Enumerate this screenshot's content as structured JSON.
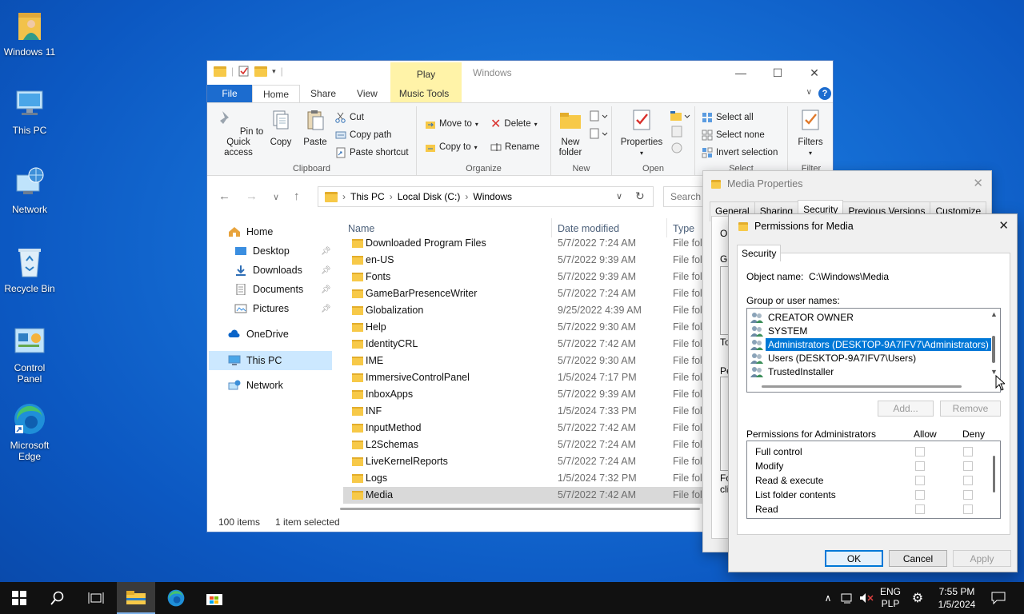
{
  "desktop": {
    "icons": [
      {
        "label": "Windows 11"
      },
      {
        "label": "This PC"
      },
      {
        "label": "Network"
      },
      {
        "label": "Recycle Bin"
      },
      {
        "label": "Control Panel"
      },
      {
        "label": "Microsoft Edge"
      }
    ]
  },
  "explorer": {
    "title": "Windows",
    "play_tab": "Play",
    "tabs": {
      "file": "File",
      "home": "Home",
      "share": "Share",
      "view": "View",
      "music_tools": "Music Tools"
    },
    "ribbon": {
      "pin": "Pin to Quick access",
      "copy": "Copy",
      "paste": "Paste",
      "cut": "Cut",
      "copy_path": "Copy path",
      "paste_shortcut": "Paste shortcut",
      "clipboard": "Clipboard",
      "move_to": "Move to",
      "copy_to": "Copy to",
      "delete": "Delete",
      "rename": "Rename",
      "organize": "Organize",
      "new_folder": "New folder",
      "new": "New",
      "properties": "Properties",
      "open": "Open",
      "select_all": "Select all",
      "select_none": "Select none",
      "invert_selection": "Invert selection",
      "select": "Select",
      "filters": "Filters",
      "filter": "Filter"
    },
    "address": {
      "p1": "This PC",
      "p2": "Local Disk (C:)",
      "p3": "Windows"
    },
    "search_placeholder": "Search W",
    "nav": {
      "home": "Home",
      "desktop": "Desktop",
      "downloads": "Downloads",
      "documents": "Documents",
      "pictures": "Pictures",
      "onedrive": "OneDrive",
      "this_pc": "This PC",
      "network": "Network"
    },
    "columns": {
      "name": "Name",
      "date": "Date modified",
      "type": "Type"
    },
    "files": [
      {
        "name": "Downloaded Program Files",
        "date": "5/7/2022 7:24 AM",
        "type": "File folde"
      },
      {
        "name": "en-US",
        "date": "5/7/2022 9:39 AM",
        "type": "File folde"
      },
      {
        "name": "Fonts",
        "date": "5/7/2022 9:39 AM",
        "type": "File folde"
      },
      {
        "name": "GameBarPresenceWriter",
        "date": "5/7/2022 7:24 AM",
        "type": "File folde"
      },
      {
        "name": "Globalization",
        "date": "9/25/2022 4:39 AM",
        "type": "File folde"
      },
      {
        "name": "Help",
        "date": "5/7/2022 9:30 AM",
        "type": "File folde"
      },
      {
        "name": "IdentityCRL",
        "date": "5/7/2022 7:42 AM",
        "type": "File folde"
      },
      {
        "name": "IME",
        "date": "5/7/2022 9:30 AM",
        "type": "File folde"
      },
      {
        "name": "ImmersiveControlPanel",
        "date": "1/5/2024 7:17 PM",
        "type": "File folde"
      },
      {
        "name": "InboxApps",
        "date": "5/7/2022 9:39 AM",
        "type": "File folde"
      },
      {
        "name": "INF",
        "date": "1/5/2024 7:33 PM",
        "type": "File folde"
      },
      {
        "name": "InputMethod",
        "date": "5/7/2022 7:42 AM",
        "type": "File folde"
      },
      {
        "name": "L2Schemas",
        "date": "5/7/2022 7:24 AM",
        "type": "File folde"
      },
      {
        "name": "LiveKernelReports",
        "date": "5/7/2022 7:24 AM",
        "type": "File folde"
      },
      {
        "name": "Logs",
        "date": "1/5/2024 7:32 PM",
        "type": "File folde"
      },
      {
        "name": "Media",
        "date": "5/7/2022 7:42 AM",
        "type": "File folde"
      }
    ],
    "status": {
      "count": "100 items",
      "selected": "1 item selected"
    }
  },
  "media_props": {
    "title": "Media Properties",
    "tabs": [
      "General",
      "Sharing",
      "Security",
      "Previous Versions",
      "Customize"
    ],
    "frag1": "Ob",
    "frag2": "Gr",
    "frag3": "To",
    "frag4": "Pe",
    "frag5": "Fo",
    "frag6": "cli"
  },
  "perm": {
    "title": "Permissions for Media",
    "tab": "Security",
    "object_label": "Object name:",
    "object_value": "C:\\Windows\\Media",
    "group_label": "Group or user names:",
    "users": [
      {
        "name": "CREATOR OWNER"
      },
      {
        "name": "SYSTEM"
      },
      {
        "name": "Administrators (DESKTOP-9A7IFV7\\Administrators)"
      },
      {
        "name": "Users (DESKTOP-9A7IFV7\\Users)"
      },
      {
        "name": "TrustedInstaller"
      }
    ],
    "add": "Add...",
    "remove": "Remove",
    "perms_for": "Permissions for Administrators",
    "allow": "Allow",
    "deny": "Deny",
    "perms": [
      "Full control",
      "Modify",
      "Read & execute",
      "List folder contents",
      "Read"
    ],
    "ok": "OK",
    "cancel": "Cancel",
    "apply": "Apply"
  },
  "taskbar": {
    "lang1": "ENG",
    "lang2": "PLP",
    "time": "7:55 PM",
    "date": "1/5/2024"
  },
  "colors": {
    "accent": "#0078d7",
    "file_tab": "#1c6ccf",
    "play_tab": "#fff3a8",
    "folder": "#f7c948"
  }
}
